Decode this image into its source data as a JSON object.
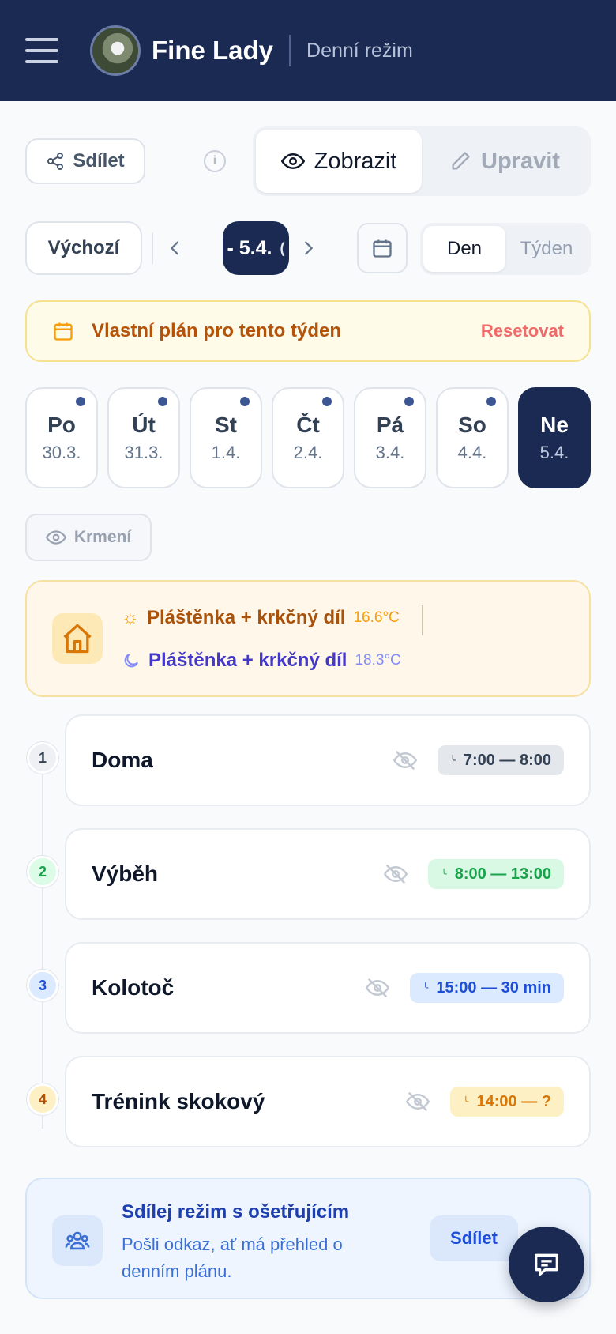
{
  "header": {
    "title": "Fine Lady",
    "subtitle": "Denní režim"
  },
  "toolbar": {
    "share_label": "Sdílet",
    "mode_view": "Zobrazit",
    "mode_edit": "Upravit"
  },
  "nav": {
    "default_label": "Výchozí",
    "current_date": "- 5.4.",
    "current_date_suffix": "(",
    "view_day": "Den",
    "view_week": "Týden"
  },
  "banner": {
    "text": "Vlastní plán pro tento týden",
    "reset": "Resetovat"
  },
  "days": [
    {
      "name": "Po",
      "date": "30.3."
    },
    {
      "name": "Út",
      "date": "31.3."
    },
    {
      "name": "St",
      "date": "1.4."
    },
    {
      "name": "Čt",
      "date": "2.4."
    },
    {
      "name": "Pá",
      "date": "3.4."
    },
    {
      "name": "So",
      "date": "4.4."
    },
    {
      "name": "Ne",
      "date": "5.4."
    }
  ],
  "feeding_toggle": "Krmení",
  "weather": {
    "day_text": "Pláštěnka + krkčný díl",
    "day_temp": "16.6°C",
    "night_text": "Pláštěnka + krkčný díl",
    "night_temp": "18.3°C"
  },
  "activities": [
    {
      "num": "1",
      "title": "Doma",
      "time": "7:00 — 8:00"
    },
    {
      "num": "2",
      "title": "Výběh",
      "time": "8:00 — 13:00"
    },
    {
      "num": "3",
      "title": "Kolotoč",
      "time": "15:00 — 30 min"
    },
    {
      "num": "4",
      "title": "Trénink skokový",
      "time": "14:00 — ?"
    }
  ],
  "share_card": {
    "title": "Sdílej režim s ošetřujícím",
    "description": "Pošli odkaz, ať má přehled o denním plánu.",
    "button": "Sdílet"
  },
  "colors": {
    "navy": "#1a2a52",
    "warning": "#b45309",
    "reset": "#ef6b6b"
  },
  "icons": [
    "menu-icon",
    "share-icon",
    "info-icon",
    "eye-icon",
    "pencil-icon",
    "chevron-left-icon",
    "chevron-right-icon",
    "calendar-icon",
    "house-icon",
    "sun-icon",
    "moon-icon",
    "eye-off-icon",
    "clock-icon",
    "users-icon",
    "chat-icon"
  ]
}
